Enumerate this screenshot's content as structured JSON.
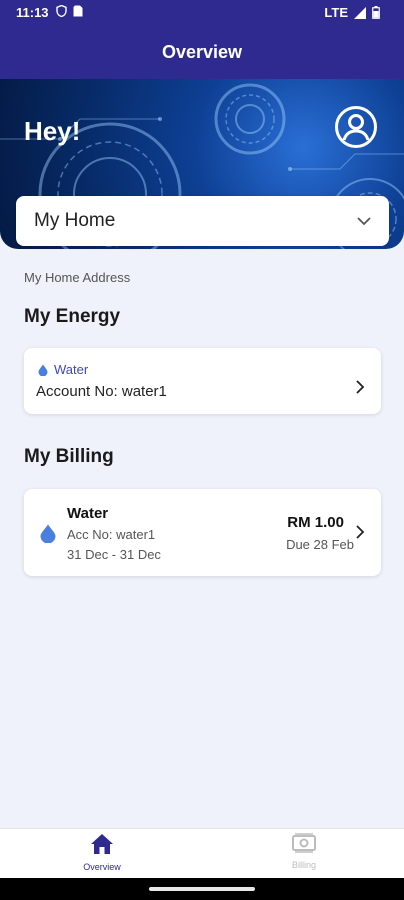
{
  "status_bar": {
    "time": "11:13",
    "network": "LTE"
  },
  "app_bar": {
    "title": "Overview"
  },
  "hero": {
    "greeting": "Hey!"
  },
  "home_select": {
    "value": "My Home"
  },
  "address": "My Home Address",
  "energy": {
    "section_title": "My Energy",
    "card": {
      "type": "Water",
      "account": "Account No: water1"
    }
  },
  "billing": {
    "section_title": "My Billing",
    "card": {
      "title": "Water",
      "account": "Acc No: water1",
      "period": "31 Dec - 31 Dec",
      "amount": "RM 1.00",
      "due": "Due 28 Feb"
    }
  },
  "bottom_nav": {
    "items": [
      {
        "label": "Overview",
        "icon": "home-icon",
        "active": true
      },
      {
        "label": "Billing",
        "icon": "bill-icon",
        "active": false
      }
    ]
  },
  "colors": {
    "primary": "#2e2a8f",
    "accent": "#3f48b0",
    "water": "#4a7fe0",
    "background": "#eff2fb"
  }
}
